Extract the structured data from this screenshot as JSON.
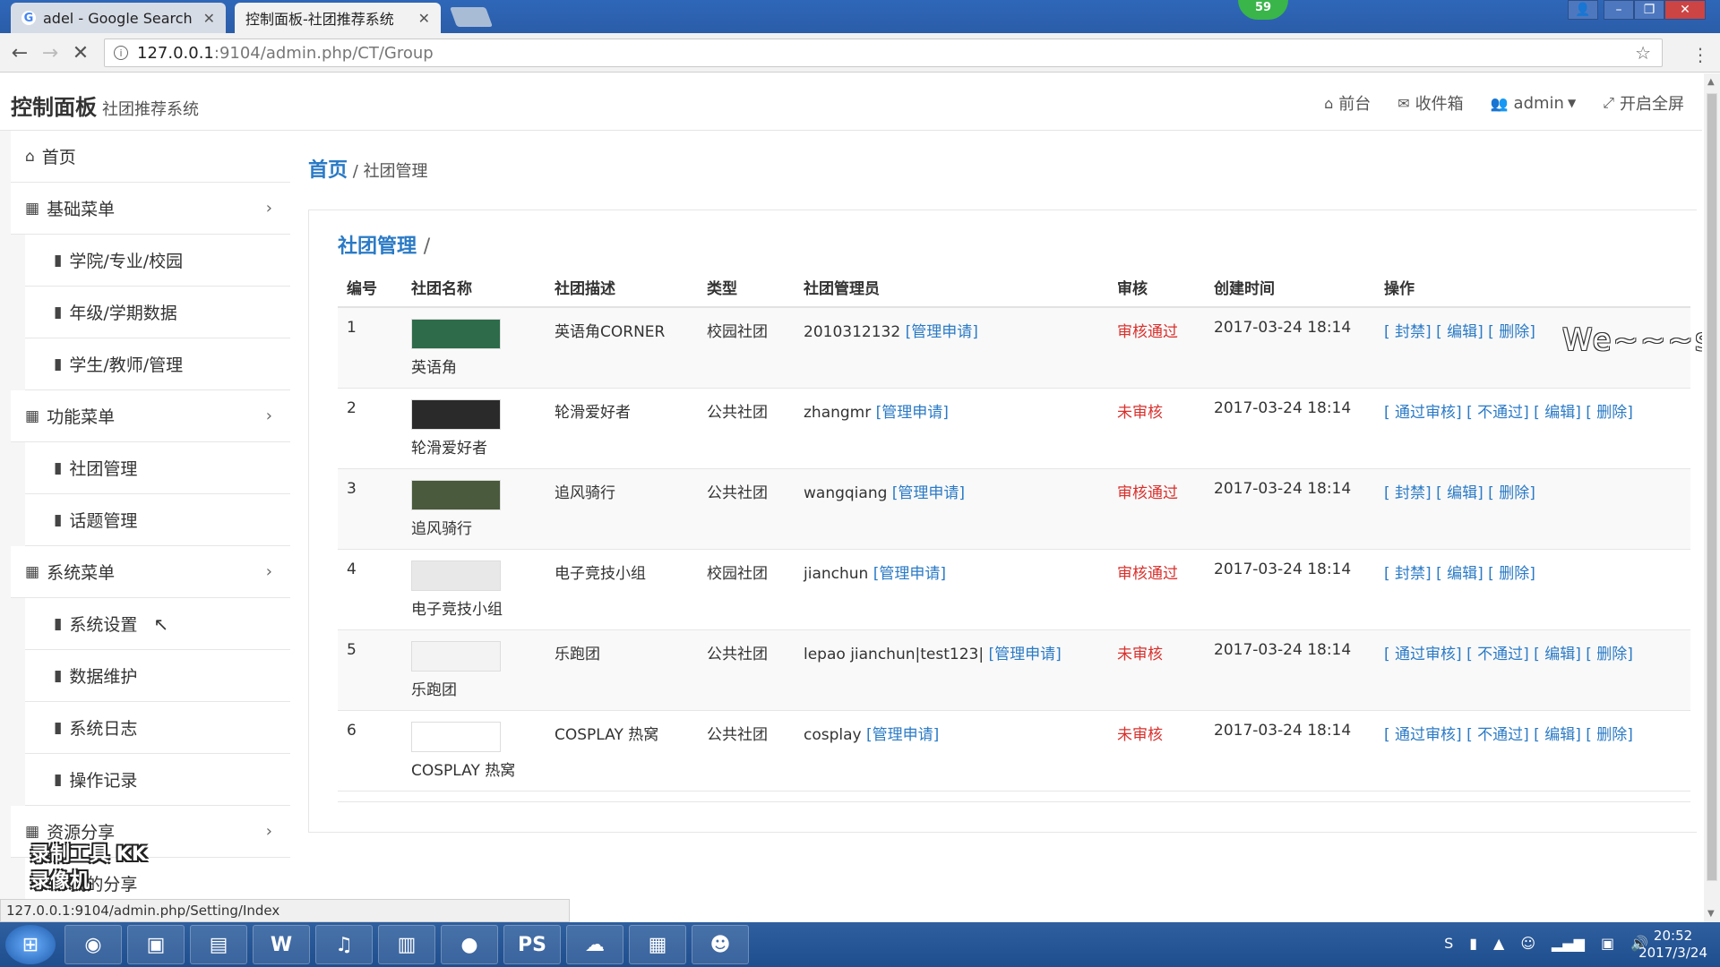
{
  "browser": {
    "tabs": [
      {
        "label": "adel - Google Search",
        "active": false
      },
      {
        "label": "控制面板-社团推荐系统",
        "active": true
      }
    ],
    "url_host": "127.0.0.1",
    "url_path": ":9104/admin.php/CT/Group",
    "badge": "59",
    "status_url": "127.0.0.1:9104/admin.php/Setting/Index"
  },
  "header": {
    "title": "控制面板",
    "subtitle": "社团推荐系统",
    "nav": [
      {
        "label": "前台",
        "icon": "home-icon"
      },
      {
        "label": "收件箱",
        "icon": "envelope-icon"
      },
      {
        "label": "admin",
        "icon": "users-icon"
      },
      {
        "label": "开启全屏",
        "icon": "fullscreen-icon"
      }
    ]
  },
  "sidebar": {
    "home": "首页",
    "groups": [
      {
        "label": "基础菜单",
        "items": [
          "学院/专业/校园",
          "年级/学期数据",
          "学生/教师/管理"
        ]
      },
      {
        "label": "功能菜单",
        "items": [
          "社团管理",
          "话题管理"
        ]
      },
      {
        "label": "系统菜单",
        "items": [
          "系统设置",
          "数据维护",
          "系统日志",
          "操作记录"
        ]
      },
      {
        "label": "资源分享",
        "items": [
          "我的分享"
        ]
      }
    ]
  },
  "breadcrumb": {
    "home": "首页",
    "separator": "/",
    "current": "社团管理"
  },
  "panel": {
    "title": "社团管理",
    "slash": "/"
  },
  "table": {
    "columns": [
      "编号",
      "社团名称",
      "社团描述",
      "类型",
      "社团管理员",
      "审核",
      "创建时间",
      "操作"
    ],
    "rows": [
      {
        "id": "1",
        "name": "英语角",
        "desc": "英语角CORNER",
        "type": "校园社团",
        "admin": "2010312132",
        "apply": "[管理申请]",
        "status": "审核通过",
        "time": "2017-03-24 18:14",
        "ops": [
          "[ 封禁]",
          "[ 编辑]",
          "[ 删除]"
        ],
        "thumb_color": "#2d6b4a"
      },
      {
        "id": "2",
        "name": "轮滑爱好者",
        "desc": "轮滑爱好者",
        "type": "公共社团",
        "admin": "zhangmr",
        "apply": "[管理申请]",
        "status": "未审核",
        "time": "2017-03-24 18:14",
        "ops": [
          "[ 通过审核]",
          "[ 不通过]",
          "[ 编辑]",
          "[ 删除]"
        ],
        "thumb_color": "#2a2a2a"
      },
      {
        "id": "3",
        "name": "追风骑行",
        "desc": "追风骑行",
        "type": "公共社团",
        "admin": "wangqiang",
        "apply": "[管理申请]",
        "status": "审核通过",
        "time": "2017-03-24 18:14",
        "ops": [
          "[ 封禁]",
          "[ 编辑]",
          "[ 删除]"
        ],
        "thumb_color": "#4a5a3c"
      },
      {
        "id": "4",
        "name": "电子竞技小组",
        "desc": "电子竞技小组",
        "type": "校园社团",
        "admin": "jianchun",
        "apply": "[管理申请]",
        "status": "审核通过",
        "time": "2017-03-24 18:14",
        "ops": [
          "[ 封禁]",
          "[ 编辑]",
          "[ 删除]"
        ],
        "thumb_color": "#e8e8e8"
      },
      {
        "id": "5",
        "name": "乐跑团",
        "desc": "乐跑团",
        "type": "公共社团",
        "admin": "lepao jianchun|test123|",
        "apply": "[管理申请]",
        "status": "未审核",
        "time": "2017-03-24 18:14",
        "ops": [
          "[ 通过审核]",
          "[ 不通过]",
          "[ 编辑]",
          "[ 删除]"
        ],
        "thumb_color": "#f3f3f3"
      },
      {
        "id": "6",
        "name": "COSPLAY 热窝",
        "desc": "COSPLAY 热窝",
        "type": "公共社团",
        "admin": "cosplay",
        "apply": "[管理申请]",
        "status": "未审核",
        "time": "2017-03-24 18:14",
        "ops": [
          "[ 通过审核]",
          "[ 不通过]",
          "[ 编辑]",
          "[ 删除]"
        ],
        "thumb_color": "#ffffff"
      }
    ]
  },
  "overlay": {
    "scribble": "We~~~say~~~~",
    "watermark": "录制工具 KK录像机"
  },
  "taskbar": {
    "time": "20:52",
    "date": "2017/3/24"
  },
  "colors": {
    "accent": "#2a7ac6",
    "status": "#d9302c"
  }
}
